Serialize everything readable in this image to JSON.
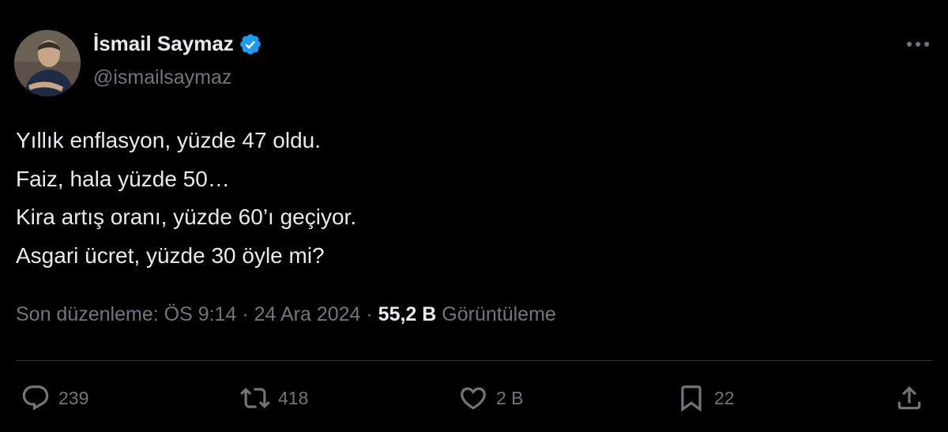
{
  "author": {
    "name": "İsmail Saymaz",
    "handle": "@ismailsaymaz",
    "verified_icon": "verified-badge-icon",
    "verified_color": "#1d9bf0"
  },
  "tweet": {
    "lines": [
      "Yıllık enflasyon, yüzde 47 oldu.",
      "Faiz, hala yüzde 50…",
      "Kira artış oranı, yüzde 60’ı geçiyor.",
      "Asgari ücret, yüzde 30 öyle mi?"
    ]
  },
  "meta": {
    "edited_label": "Son düzenleme: ÖS 9:14",
    "separator": "·",
    "date": "24 Ara 2024",
    "views_count": "55,2 B",
    "views_label": "Görüntüleme"
  },
  "actions": {
    "replies": "239",
    "reposts": "418",
    "likes": "2 B",
    "bookmarks": "22"
  },
  "colors": {
    "background": "#000000",
    "text": "#e7e9ea",
    "secondary": "#71767b",
    "divider": "#2f3336"
  }
}
